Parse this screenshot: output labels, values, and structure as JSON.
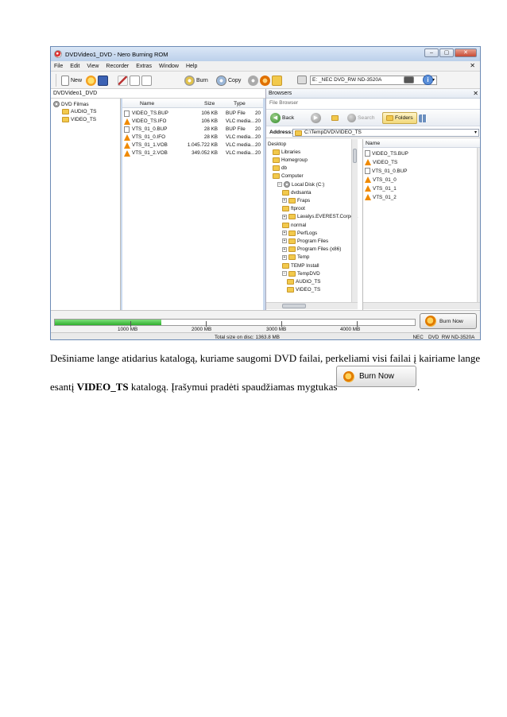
{
  "window": {
    "title": "DVDVideo1_DVD - Nero Burning ROM",
    "controls": [
      "–",
      "▢",
      "✕"
    ]
  },
  "menu": [
    "File",
    "Edit",
    "View",
    "Recorder",
    "Extras",
    "Window",
    "Help"
  ],
  "menu_close": "✕",
  "toolbar": {
    "new_label": "New",
    "burn_label": "Burn",
    "copy_label": "Copy",
    "drive": "E: _NEC DVD_RW ND-3520A"
  },
  "compilation": {
    "name": "DVDVideo1_DVD",
    "tree": [
      {
        "label": "DVD Filmas",
        "icon": "disc-icon"
      },
      {
        "label": "AUDIO_TS",
        "icon": "folder-icon"
      },
      {
        "label": "VIDEO_TS",
        "icon": "folder-icon"
      }
    ],
    "columns": [
      "Name",
      "Size",
      "Type"
    ],
    "files": [
      {
        "name": "VIDEO_TS.BUP",
        "size": "106 KB",
        "type": "BUP File",
        "extra": "20",
        "icon": "doc"
      },
      {
        "name": "VIDEO_TS.IFO",
        "size": "106 KB",
        "type": "VLC media...",
        "extra": "20",
        "icon": "vlc"
      },
      {
        "name": "VTS_01_0.BUP",
        "size": "28 KB",
        "type": "BUP File",
        "extra": "20",
        "icon": "doc"
      },
      {
        "name": "VTS_01_0.IFO",
        "size": "28 KB",
        "type": "VLC media...",
        "extra": "20",
        "icon": "vlc"
      },
      {
        "name": "VTS_01_1.VOB",
        "size": "1.045.722 KB",
        "type": "VLC media...",
        "extra": "20",
        "icon": "vlc"
      },
      {
        "name": "VTS_01_2.VOB",
        "size": "349.052 KB",
        "type": "VLC media...",
        "extra": "20",
        "icon": "vlc"
      }
    ]
  },
  "browser": {
    "title": "Browsers",
    "close": "✕",
    "tab": "File Browser",
    "back_label": "Back",
    "search_label": "Search",
    "folders_label": "Folders",
    "address_label": "Address:",
    "address": "C:\\TempDVD\\VIDEO_TS",
    "tree": [
      {
        "label": "Desktop",
        "indent": 0,
        "icon": "none",
        "exp": ""
      },
      {
        "label": "Libraries",
        "indent": 1,
        "icon": "folder",
        "exp": ""
      },
      {
        "label": "Homegroup",
        "indent": 1,
        "icon": "folder",
        "exp": ""
      },
      {
        "label": "db",
        "indent": 1,
        "icon": "folder",
        "exp": ""
      },
      {
        "label": "Computer",
        "indent": 1,
        "icon": "folder",
        "exp": ""
      },
      {
        "label": "Local Disk (C:)",
        "indent": 2,
        "icon": "disc",
        "exp": "−"
      },
      {
        "label": "dvdsanta",
        "indent": 3,
        "icon": "folder",
        "exp": ""
      },
      {
        "label": "Fraps",
        "indent": 3,
        "icon": "folder",
        "exp": "+"
      },
      {
        "label": "ftproot",
        "indent": 3,
        "icon": "folder",
        "exp": ""
      },
      {
        "label": "Lavalys.EVEREST.Corpora",
        "indent": 3,
        "icon": "folder",
        "exp": "+"
      },
      {
        "label": "normal",
        "indent": 3,
        "icon": "folder",
        "exp": ""
      },
      {
        "label": "PerfLogs",
        "indent": 3,
        "icon": "folder",
        "exp": "+"
      },
      {
        "label": "Program Files",
        "indent": 3,
        "icon": "folder",
        "exp": "+"
      },
      {
        "label": "Program Files (x86)",
        "indent": 3,
        "icon": "folder",
        "exp": "+"
      },
      {
        "label": "Temp",
        "indent": 3,
        "icon": "folder",
        "exp": "+"
      },
      {
        "label": "TEMP Install",
        "indent": 3,
        "icon": "folder",
        "exp": ""
      },
      {
        "label": "TempDVD",
        "indent": 3,
        "icon": "folder",
        "exp": "−"
      },
      {
        "label": "AUDIO_TS",
        "indent": 4,
        "icon": "folder",
        "exp": ""
      },
      {
        "label": "VIDEO_TS",
        "indent": 4,
        "icon": "folder",
        "exp": ""
      }
    ],
    "files_header": "Name",
    "files": [
      {
        "name": "VIDEO_TS.BUP",
        "icon": "doc"
      },
      {
        "name": "VIDEO_TS",
        "icon": "vlc"
      },
      {
        "name": "VTS_01_0.BUP",
        "icon": "doc"
      },
      {
        "name": "VTS_01_0",
        "icon": "vlc"
      },
      {
        "name": "VTS_01_1",
        "icon": "vlc"
      },
      {
        "name": "VTS_01_2",
        "icon": "vlc"
      }
    ]
  },
  "capacity": {
    "labels": [
      "1000 MB",
      "2000 MB",
      "3000 MB",
      "4000 MB"
    ],
    "fill_fraction": 0.295,
    "burn_now_label": "Burn Now"
  },
  "status": {
    "total": "Total size on disc: 1363.8 MB",
    "drive": "_NEC",
    "drive_model": "DVD_RW ND-3520A"
  },
  "doc": {
    "line1": "Dešiniame lange atidarius katalogą, kuriame saugomi DVD failai, perkeliami visi failai į kairiame lange",
    "line2_prefix": "esantį ",
    "line2_bold": "VIDEO_TS",
    "line2_suffix": " katalogą. Įrašymui pradėti spaudžiamas mygtukas",
    "button_label": "Burn Now",
    "period": "."
  }
}
